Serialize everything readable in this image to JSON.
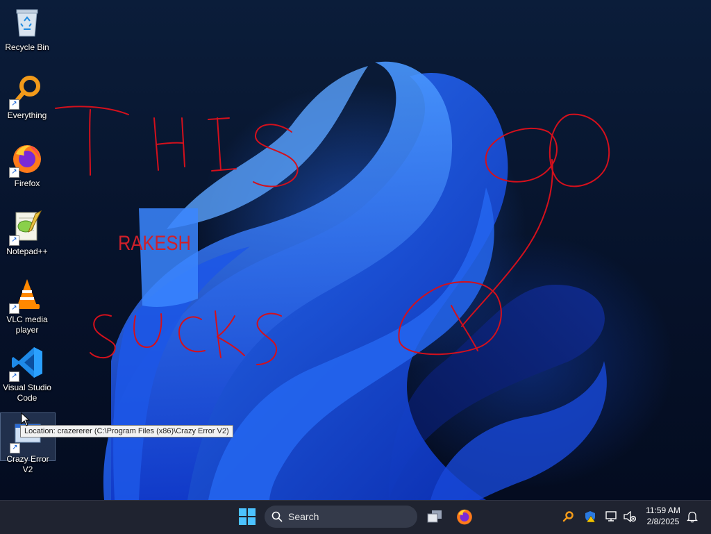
{
  "desktop_icons": [
    {
      "label": "Recycle Bin",
      "icon": "recycle-bin-icon"
    },
    {
      "label": "Everything",
      "icon": "everything-search-icon"
    },
    {
      "label": "Firefox",
      "icon": "firefox-icon"
    },
    {
      "label": "Notepad++",
      "icon": "notepad-plus-plus-icon"
    },
    {
      "label": "VLC media player",
      "icon": "vlc-icon"
    },
    {
      "label": "Visual Studio Code",
      "icon": "vscode-icon"
    },
    {
      "label": "Crazy Error V2",
      "icon": "crazy-error-icon"
    }
  ],
  "tooltip": "Location: crazererer (C:\\Program Files (x86)\\Crazy Error V2)",
  "overlay_text": {
    "rakesh": "RAKESH"
  },
  "taskbar": {
    "search_placeholder": "Search",
    "pinned": [
      "start-icon",
      "task-view-icon",
      "firefox-icon"
    ],
    "tray": [
      "everything-search-icon",
      "security-warning-icon",
      "network-icon",
      "volume-muted-icon",
      "notification-bell-icon"
    ]
  },
  "clock": {
    "time": "11:59 AM",
    "date": "2/8/2025"
  },
  "colors": {
    "accent": "#1e5bff",
    "scribble": "#d4101c",
    "taskbar": "#1f2330"
  }
}
